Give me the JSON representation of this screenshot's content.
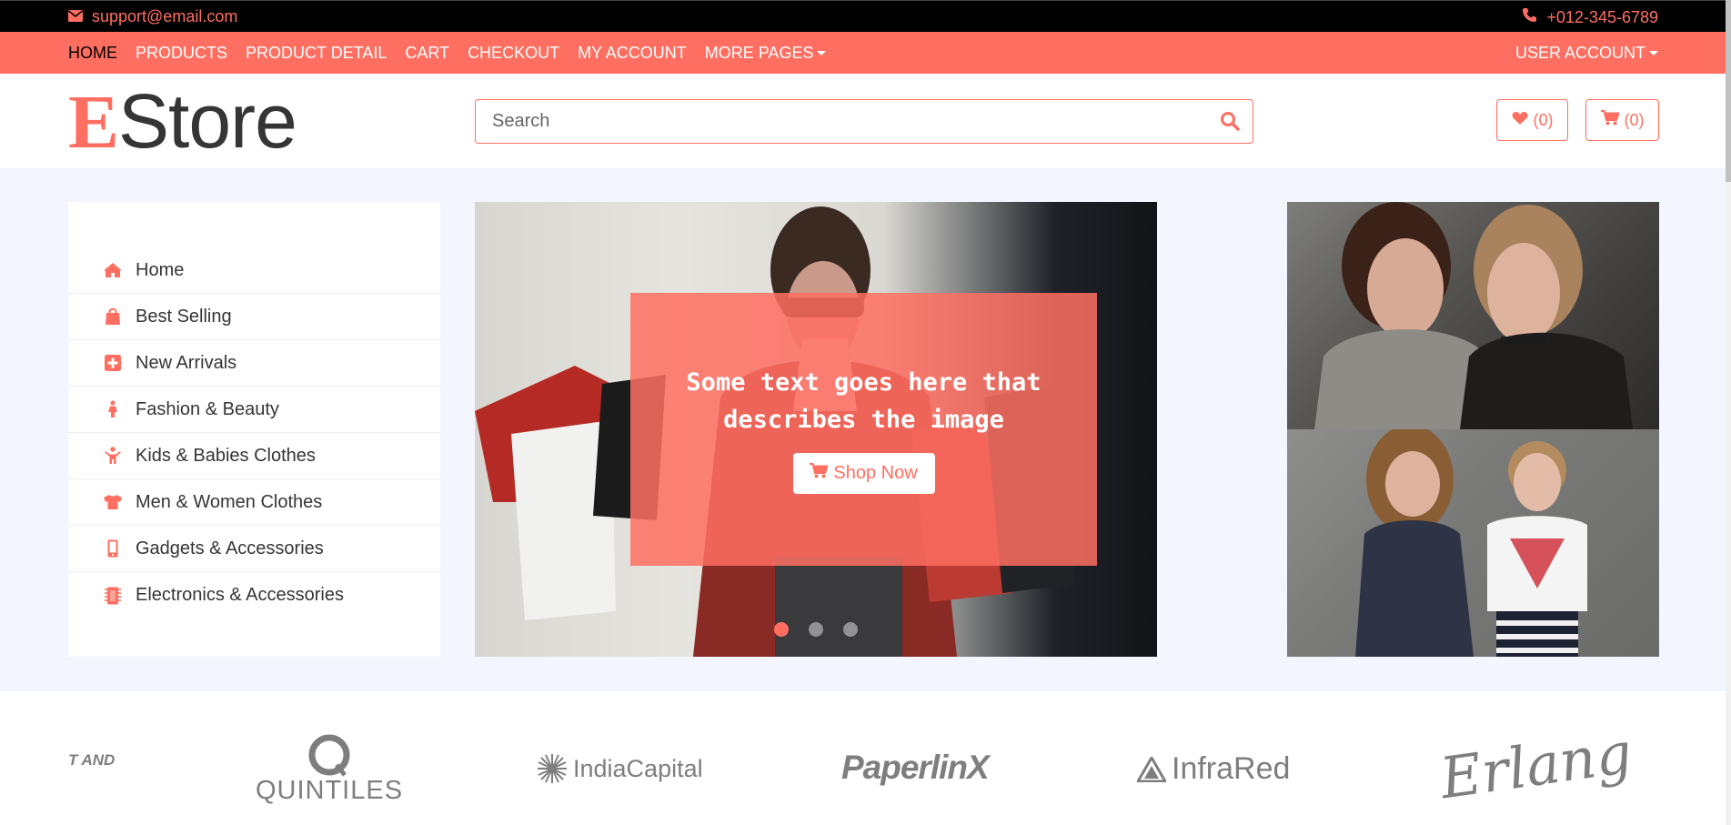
{
  "topbar": {
    "email": "support@email.com",
    "phone": "+012-345-6789"
  },
  "nav": {
    "items": [
      "HOME",
      "PRODUCTS",
      "PRODUCT DETAIL",
      "CART",
      "CHECKOUT",
      "MY ACCOUNT"
    ],
    "more": "MORE PAGES",
    "user": "USER ACCOUNT"
  },
  "header": {
    "logo_first": "E",
    "logo_rest": "Store",
    "search_placeholder": "Search",
    "wishlist_count": "(0)",
    "cart_count": "(0)"
  },
  "sidebar": {
    "items": [
      {
        "label": "Home",
        "icon": "home-icon"
      },
      {
        "label": "Best Selling",
        "icon": "shopping-bag-icon"
      },
      {
        "label": "New Arrivals",
        "icon": "plus-square-icon"
      },
      {
        "label": "Fashion & Beauty",
        "icon": "female-icon"
      },
      {
        "label": "Kids & Babies Clothes",
        "icon": "child-icon"
      },
      {
        "label": "Men & Women Clothes",
        "icon": "tshirt-icon"
      },
      {
        "label": "Gadgets & Accessories",
        "icon": "mobile-icon"
      },
      {
        "label": "Electronics & Accessories",
        "icon": "microchip-icon"
      }
    ]
  },
  "slider": {
    "caption": "Some text goes here that describes the image",
    "button": "Shop Now",
    "slides": 3,
    "active": 1
  },
  "brands": {
    "items": [
      "T AND",
      "QUINTILES",
      "IndiaCapital",
      "PaperlinX",
      "InfraRed",
      "Erlang"
    ]
  },
  "colors": {
    "accent": "#ff6f61",
    "topbar": "#000000",
    "main_bg": "#f3f6ff"
  }
}
